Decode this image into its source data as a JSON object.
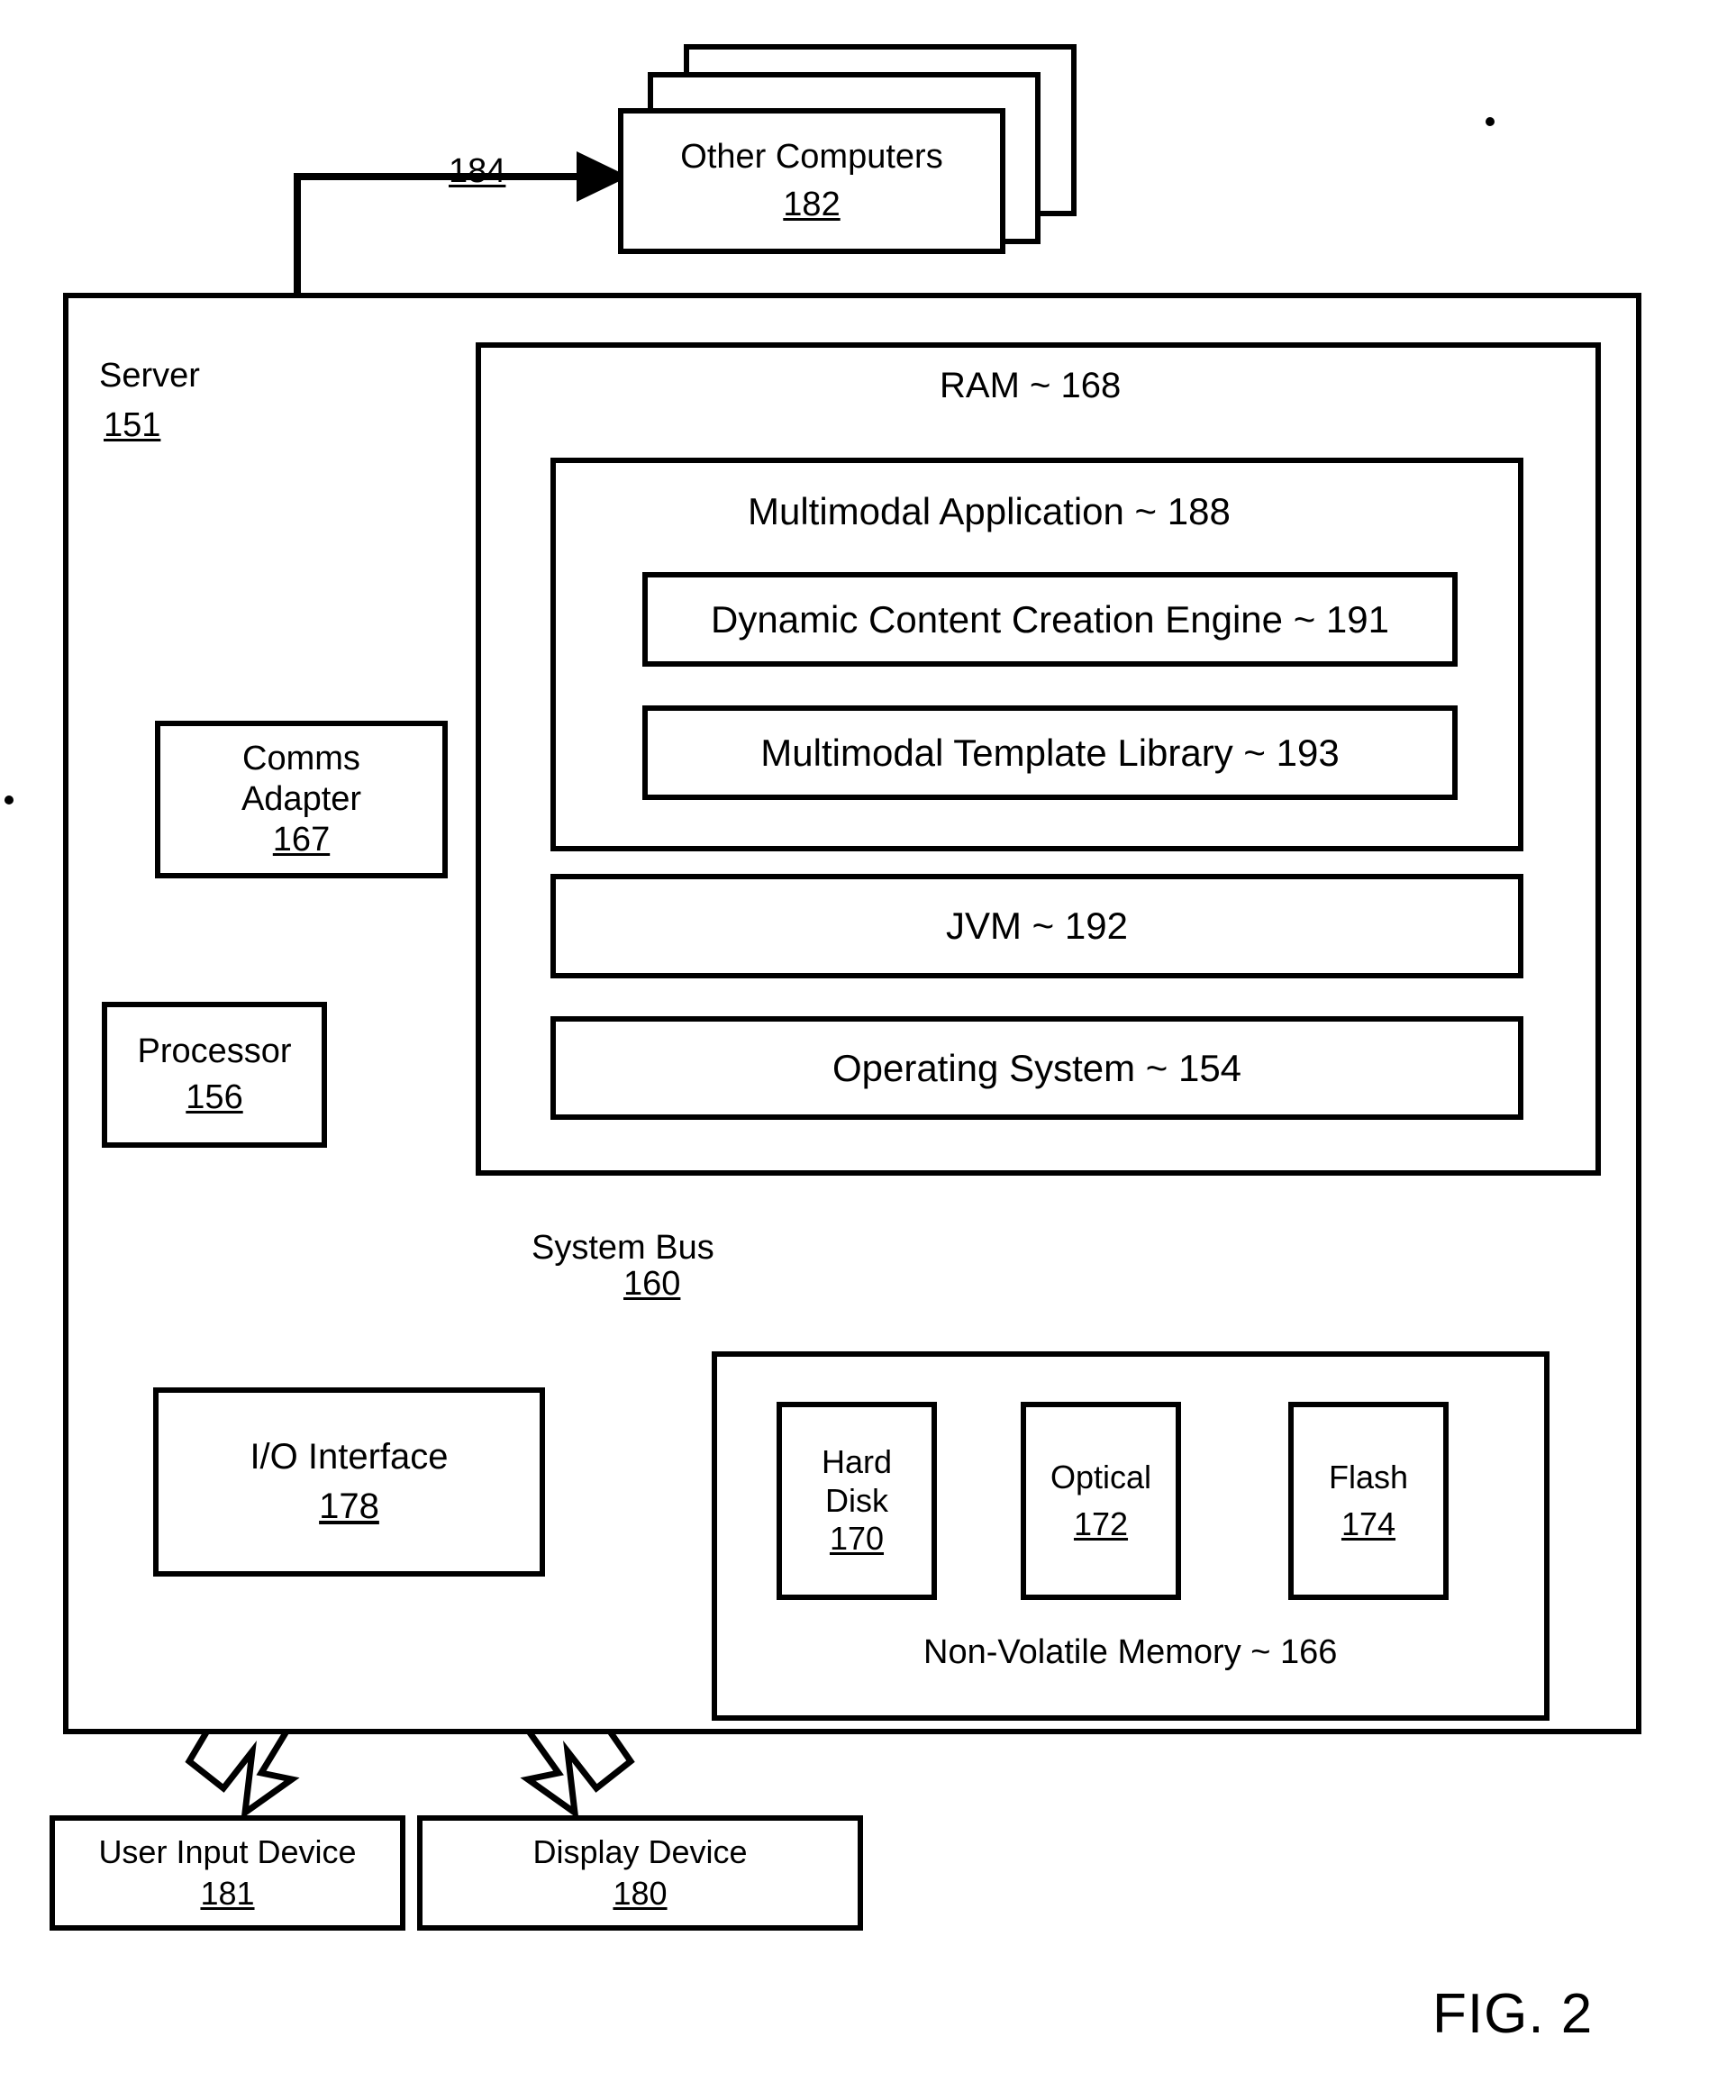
{
  "figure": {
    "caption": "FIG. 2"
  },
  "network": {
    "other_computers": {
      "title": "Other Computers",
      "ref": "182"
    },
    "link_ref": "184"
  },
  "server": {
    "title": "Server",
    "ref": "151",
    "ram": {
      "title": "RAM ~ 168",
      "multimodal_application": {
        "title": "Multimodal Application ~ 188",
        "children": [
          {
            "title": "Dynamic Content Creation Engine ~ 191"
          },
          {
            "title": "Multimodal Template Library ~ 193"
          }
        ]
      },
      "jvm": {
        "title": "JVM ~ 192"
      },
      "operating_system": {
        "title": "Operating System ~ 154"
      }
    },
    "comms_adapter": {
      "line1": "Comms",
      "line2": "Adapter",
      "ref": "167"
    },
    "processor": {
      "title": "Processor",
      "ref": "156"
    },
    "system_bus": {
      "title": "System Bus",
      "ref": "160"
    },
    "io_interface": {
      "title": "I/O Interface",
      "ref": "178"
    },
    "non_volatile_memory": {
      "title": "Non-Volatile Memory ~ 166",
      "devices": [
        {
          "line1": "Hard",
          "line2": "Disk",
          "ref": "170"
        },
        {
          "line1": "Optical",
          "line2": "",
          "ref": "172"
        },
        {
          "line1": "Flash",
          "line2": "",
          "ref": "174"
        }
      ]
    }
  },
  "peripherals": [
    {
      "title": "User Input Device",
      "ref": "181"
    },
    {
      "title": "Display Device",
      "ref": "180"
    }
  ],
  "colors": {
    "stroke": "#000000",
    "background": "#ffffff"
  }
}
